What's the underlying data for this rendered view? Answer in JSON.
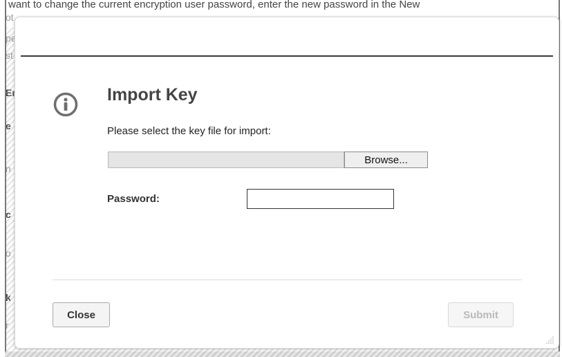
{
  "background": {
    "top_line": "want to change the current encryption user password, enter the new password in the New",
    "fragments": [
      "ot",
      "pe",
      "st",
      "Er",
      "e",
      "n",
      "c",
      "o",
      "k",
      "r"
    ],
    "right_fragment": "h"
  },
  "dialog": {
    "title": "Import Key",
    "icon": "info-icon",
    "select_label": "Please select the key file for import:",
    "file_path_value": "",
    "browse_label": "Browse...",
    "password_label": "Password:",
    "password_value": "",
    "close_label": "Close",
    "submit_label": "Submit"
  },
  "colors": {
    "title_text": "#444444",
    "icon_gray": "#6e6e6e",
    "submit_disabled_text": "#b9b9b9"
  }
}
